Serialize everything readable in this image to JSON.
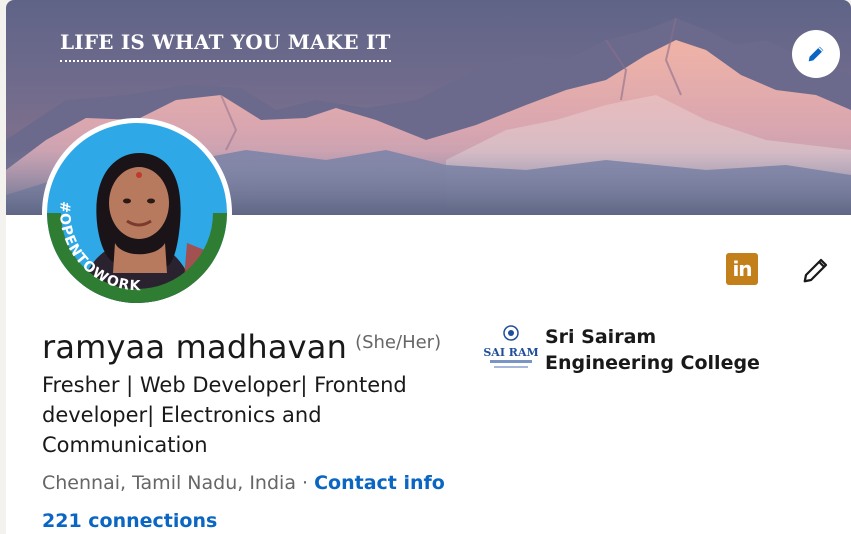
{
  "banner": {
    "quote": "LIFE IS WHAT YOU MAKE IT",
    "edit_icon": "pencil-icon"
  },
  "avatar": {
    "badge_text": "#OPENTOWORK",
    "badge_color": "#2e7d32"
  },
  "actions": {
    "linkedin_icon_text": "in",
    "linkedin_icon_color": "#c27f1a",
    "edit_icon": "pencil-icon"
  },
  "profile": {
    "name": "ramyaa madhavan",
    "pronouns": "(She/Her)",
    "headline": "Fresher | Web Developer| Frontend developer| Electronics and Communication",
    "location": "Chennai, Tamil Nadu, India",
    "separator": "·",
    "contact_info_label": "Contact info",
    "connections_label": "221 connections"
  },
  "education": {
    "name": "Sri Sairam Engineering College",
    "logo_text": "SAI RAM"
  },
  "colors": {
    "link_blue": "#0a66c2",
    "text_primary": "#191919",
    "text_secondary": "#666666"
  }
}
